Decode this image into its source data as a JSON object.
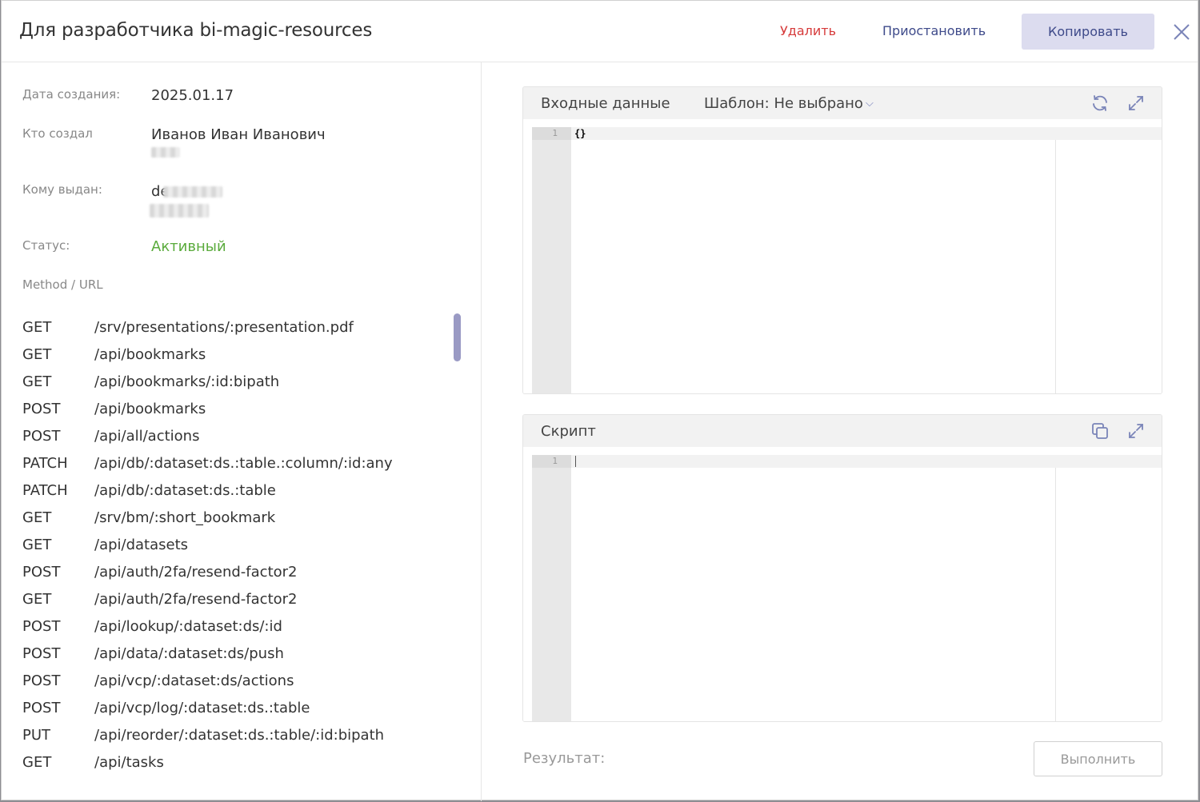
{
  "modal": {
    "title": "Для разработчика bi-magic-resources",
    "delete_label": "Удалить",
    "pause_label": "Приостановить",
    "copy_label": "Копировать"
  },
  "details": {
    "created_date_label": "Дата создания:",
    "created_date": "2025.01.17",
    "creator_label": "Кто создал",
    "creator_name": "Иванов Иван Иванович",
    "issued_to_label": "Кому выдан:",
    "issued_to_value": "de",
    "status_label": "Статус:",
    "status_value": "Активный",
    "routes_header": "Method / URL"
  },
  "routes": [
    {
      "method": "GET",
      "url": "/srv/presentations/:presentation.pdf"
    },
    {
      "method": "GET",
      "url": "/api/bookmarks"
    },
    {
      "method": "GET",
      "url": "/api/bookmarks/:id:bipath"
    },
    {
      "method": "POST",
      "url": "/api/bookmarks"
    },
    {
      "method": "POST",
      "url": "/api/all/actions"
    },
    {
      "method": "PATCH",
      "url": "/api/db/:dataset:ds.:table.:column/:id:any"
    },
    {
      "method": "PATCH",
      "url": "/api/db/:dataset:ds.:table"
    },
    {
      "method": "GET",
      "url": "/srv/bm/:short_bookmark"
    },
    {
      "method": "GET",
      "url": "/api/datasets"
    },
    {
      "method": "POST",
      "url": "/api/auth/2fa/resend-factor2"
    },
    {
      "method": "GET",
      "url": "/api/auth/2fa/resend-factor2"
    },
    {
      "method": "POST",
      "url": "/api/lookup/:dataset:ds/:id"
    },
    {
      "method": "POST",
      "url": "/api/data/:dataset:ds/push"
    },
    {
      "method": "POST",
      "url": "/api/vcp/:dataset:ds/actions"
    },
    {
      "method": "POST",
      "url": "/api/vcp/log/:dataset:ds.:table"
    },
    {
      "method": "PUT",
      "url": "/api/reorder/:dataset:ds.:table/:id:bipath"
    },
    {
      "method": "GET",
      "url": "/api/tasks"
    }
  ],
  "input_panel": {
    "title": "Входные данные",
    "template_label": "Шаблон: Не выбрано",
    "line_number": "1",
    "code": "{}"
  },
  "script_panel": {
    "title": "Скрипт",
    "line_number": "1",
    "code": ""
  },
  "result": {
    "label": "Результат:",
    "run_label": "Выполнить"
  },
  "colors": {
    "accent": "#3e4a8a",
    "danger": "#d63a3a",
    "status_active": "#5aab3c",
    "copy_button_bg": "#dcdcef"
  },
  "icons": [
    "close-icon",
    "refresh-icon",
    "expand-icon",
    "copy-icon",
    "chevron-down-icon"
  ]
}
